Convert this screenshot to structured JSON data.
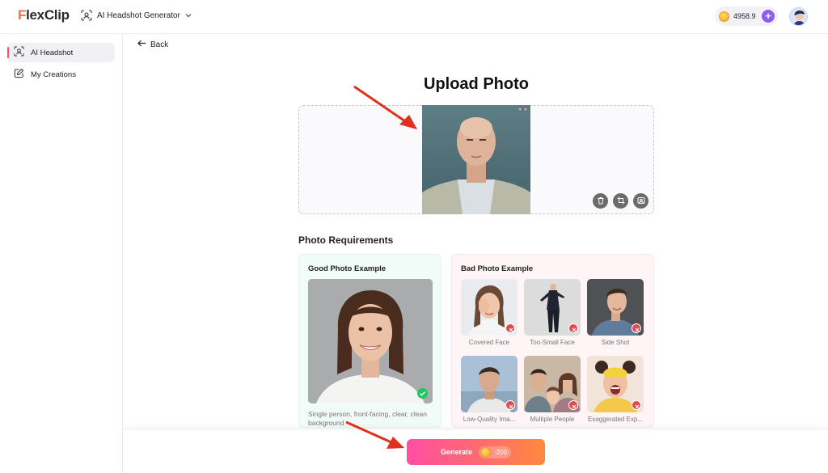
{
  "brand": {
    "logo_first": "F",
    "logo_rest": "lexClip"
  },
  "header": {
    "tool_name": "AI Headshot Generator",
    "credits": "4958.9"
  },
  "sidebar": {
    "items": [
      {
        "label": "AI Headshot",
        "active": true
      },
      {
        "label": "My Creations",
        "active": false
      }
    ]
  },
  "main": {
    "back_label": "Back",
    "title": "Upload Photo",
    "requirements_title": "Photo Requirements",
    "good": {
      "title": "Good Photo Example",
      "caption": "Single person, front-facing, clear, clean background"
    },
    "bad": {
      "title": "Bad Photo Example",
      "items": [
        {
          "label": "Covered Face"
        },
        {
          "label": "Too-Small Face"
        },
        {
          "label": "Side Shot"
        },
        {
          "label": "Low-Quality Ima..."
        },
        {
          "label": "Multiple People"
        },
        {
          "label": "Exaggerated Exp..."
        }
      ]
    }
  },
  "footer": {
    "generate_label": "Generate",
    "generate_cost": "-200"
  },
  "colors": {
    "accent_pink": "#ff4fa3",
    "accent_orange": "#ff8a3d",
    "brand_orange": "#ff6a3d",
    "credit_purple": "#8b5cf6",
    "good_green": "#22c55e",
    "bad_red": "#e5484d",
    "arrow_red": "#e0301e"
  },
  "icons": [
    "face-scan-icon",
    "chevron-down-icon",
    "coin-icon",
    "plus-icon",
    "edit-icon",
    "arrow-left-icon",
    "trash-icon",
    "crop-icon",
    "replace-photo-icon",
    "check-icon",
    "x-icon"
  ]
}
